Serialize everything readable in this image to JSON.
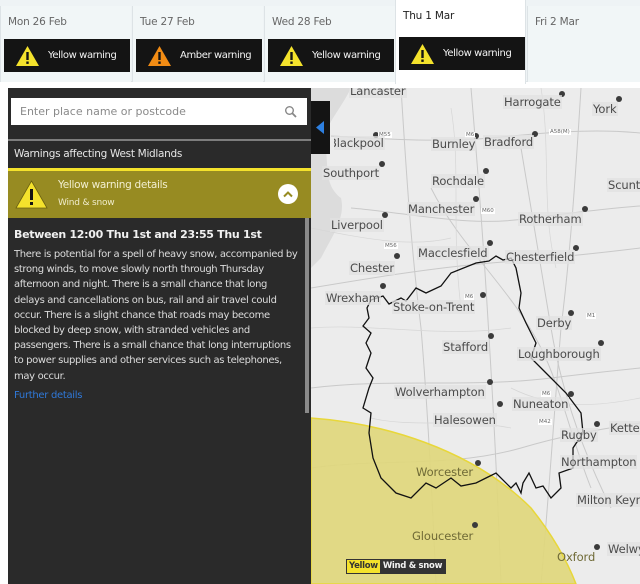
{
  "days": [
    {
      "label": "Mon 26 Feb",
      "warning": "Yellow warning",
      "level": "yellow",
      "active": false
    },
    {
      "label": "Tue 27 Feb",
      "warning": "Amber warning",
      "level": "amber",
      "active": false
    },
    {
      "label": "Wed 28 Feb",
      "warning": "Yellow warning",
      "level": "yellow",
      "active": false
    },
    {
      "label": "Thu 1 Mar",
      "warning": "Yellow warning",
      "level": "yellow",
      "active": true
    },
    {
      "label": "Fri 2 Mar",
      "warning": null,
      "level": null,
      "active": false
    }
  ],
  "colors": {
    "yellow": "#f4e22c",
    "amber": "#f28c14",
    "detail_header": "#978b22",
    "panel_bg": "#2a2a2a",
    "link": "#2f78d8",
    "warning_area": "#e0d77a"
  },
  "search": {
    "placeholder": "Enter place name or postcode",
    "value": "",
    "icon": "search-icon"
  },
  "panel": {
    "area_title": "Warnings affecting West Midlands",
    "detail": {
      "title": "Yellow warning details",
      "subtitle": "Wind & snow",
      "icon": "warning-triangle-icon",
      "collapse_icon": "chevron-up-icon"
    },
    "when": "Between 12:00 Thu 1st and 23:55 Thu 1st",
    "description": "There is potential for a spell of heavy snow, accompanied by strong winds, to move slowly north through Thursday afternoon and night. There is a small chance that long delays and cancellations on bus, rail and air travel could occur. There is a slight chance that roads may become blocked by deep snow, with stranded vehicles and passengers. There is a small chance that long interruptions to power supplies and other services such as telephones, may occur.",
    "further_link": "Further details"
  },
  "map": {
    "toggle_icon": "collapse-left-icon",
    "cities": [
      "Lancaster",
      "Harrogate",
      "York",
      "Blackpool",
      "Burnley",
      "Bradford",
      "Southport",
      "Rochdale",
      "Scunthorpe",
      "Manchester",
      "Rotherham",
      "Liverpool",
      "Macclesfield",
      "Chesterfield",
      "Chester",
      "Wrexham",
      "Stoke-on-Trent",
      "Derby",
      "Stafford",
      "Loughborough",
      "Wolverhampton",
      "Nuneaton",
      "Halesowen",
      "Rugby",
      "Kettering",
      "Northampton",
      "Worcester",
      "Milton Keynes",
      "Gloucester",
      "Welwyn",
      "Oxford"
    ],
    "roads": [
      "M55",
      "M6",
      "A58(M)",
      "M60",
      "M1",
      "M56",
      "M6",
      "M1",
      "M6",
      "M42"
    ],
    "legend": {
      "level": "Yellow",
      "type": "Wind & snow"
    }
  }
}
